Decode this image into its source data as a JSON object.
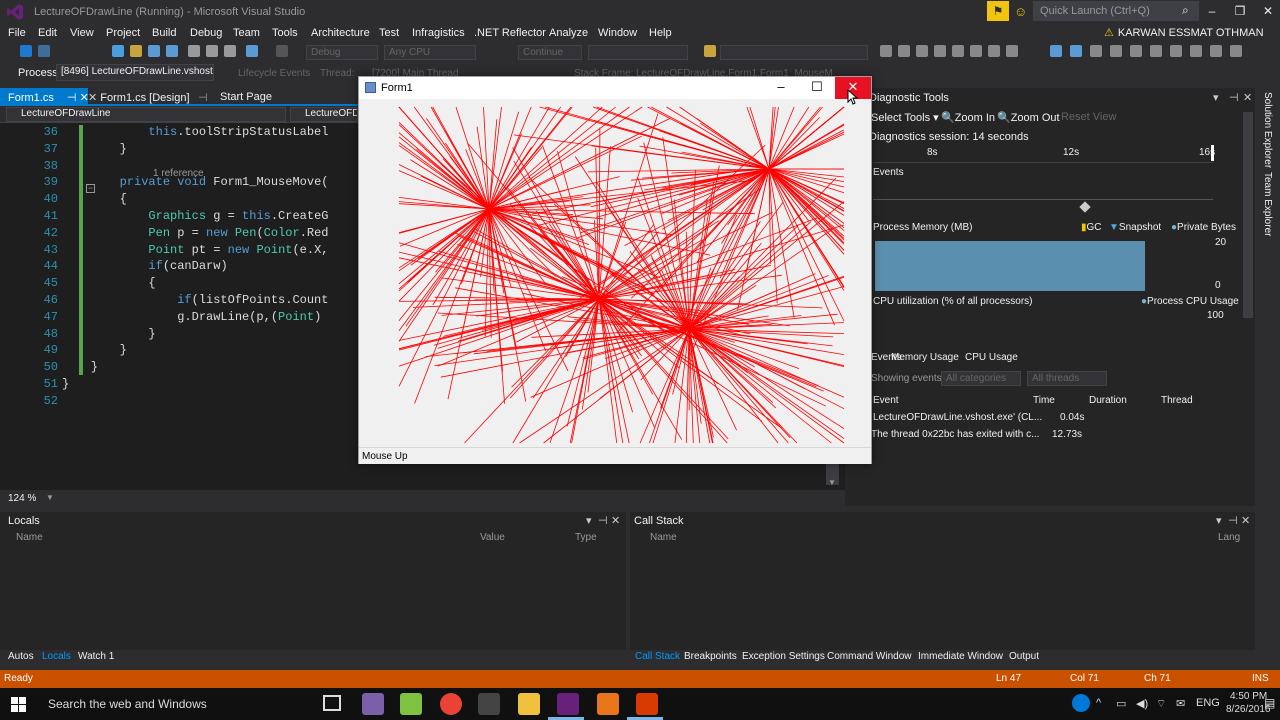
{
  "window": {
    "title": "LectureOFDrawLine (Running) - Microsoft Visual Studio",
    "quick_launch": "Quick Launch (Ctrl+Q)",
    "user": "KARWAN ESSMAT OTHMAN"
  },
  "menu": [
    "File",
    "Edit",
    "View",
    "Project",
    "Build",
    "Debug",
    "Team",
    "Tools",
    "Architecture",
    "Test",
    "Infragistics",
    ".NET Reflector",
    "Analyze",
    "Window",
    "Help"
  ],
  "toolbar": {
    "config": "Debug",
    "platform": "Any CPU",
    "continue": "Continue",
    "process_label": "Process:",
    "process_value": "[8496] LectureOFDrawLine.vshost.e",
    "lifecycle": "Lifecycle Events",
    "thread_label": "Thread:",
    "thread_value": "[7200] Main Thread",
    "stackframe_label": "Stack Frame:",
    "stackframe_value": "LectureOFDrawLine.Form1.Form1_MouseM"
  },
  "tabs": [
    {
      "label": "Form1.cs",
      "active": true
    },
    {
      "label": "Form1.cs [Design]",
      "active": false
    },
    {
      "label": "Start Page",
      "active": false
    }
  ],
  "navbar": {
    "project": "LectureOFDrawLine",
    "class": "LectureOFDra"
  },
  "editor": {
    "zoom": "124 %",
    "reference_hint": "1 reference",
    "lines": [
      {
        "n": "36",
        "text": "            this.toolStripStatusLabel"
      },
      {
        "n": "37",
        "text": "        }"
      },
      {
        "n": "38",
        "text": ""
      },
      {
        "n": "39",
        "text": "        private void Form1_MouseMove("
      },
      {
        "n": "40",
        "text": "        {"
      },
      {
        "n": "41",
        "text": "            Graphics g = this.CreateG"
      },
      {
        "n": "42",
        "text": "            Pen p = new Pen(Color.Red"
      },
      {
        "n": "43",
        "text": "            Point pt = new Point(e.X,"
      },
      {
        "n": "44",
        "text": "            if(canDarw)"
      },
      {
        "n": "45",
        "text": "            {"
      },
      {
        "n": "46",
        "text": "                if(listOfPoints.Count"
      },
      {
        "n": "47",
        "text": "                g.DrawLine(p,(Point)"
      },
      {
        "n": "48",
        "text": "            }"
      },
      {
        "n": "49",
        "text": "        }"
      },
      {
        "n": "50",
        "text": "    }"
      },
      {
        "n": "51",
        "text": "}"
      },
      {
        "n": "52",
        "text": ""
      }
    ]
  },
  "form1": {
    "title": "Form1",
    "status": "Mouse Up",
    "line_color": "#ff0000"
  },
  "diagnostics": {
    "title": "Diagnostic Tools",
    "select_tools": "Select Tools",
    "zoom_in": "Zoom In",
    "zoom_out": "Zoom Out",
    "reset_view": "Reset View",
    "session": "Diagnostics session: 14 seconds",
    "ticks": [
      "8s",
      "12s",
      "16s"
    ],
    "events_label": "Events",
    "memory_label": "Process Memory (MB)",
    "gc": "GC",
    "snapshot": "Snapshot",
    "private_bytes": "Private Bytes",
    "mem_max": "20",
    "mem_min": "0",
    "cpu_label": "CPU utilization (% of all processors)",
    "cpu_legend": "Process CPU Usage",
    "cpu_max": "100",
    "subtabs": [
      "Events",
      "Memory Usage",
      "CPU Usage"
    ],
    "showing": "Showing events for:",
    "all_categories": "All categories",
    "all_threads": "All threads",
    "cols": [
      "Event",
      "Time",
      "Duration",
      "Thread"
    ],
    "rows": [
      {
        "event": "LectureOFDrawLine.vshost.exe' (CL...",
        "time": "0.04s"
      },
      {
        "event": "The thread 0x22bc has exited with c...",
        "time": "12.73s"
      }
    ],
    "memory_color": "#5b8fb0"
  },
  "locals": {
    "title": "Locals",
    "cols": [
      "Name",
      "Value",
      "Type"
    ],
    "tabs": [
      {
        "label": "Autos",
        "sel": false
      },
      {
        "label": "Locals",
        "sel": true
      },
      {
        "label": "Watch 1",
        "sel": false
      }
    ]
  },
  "callstack": {
    "title": "Call Stack",
    "cols": [
      "Name",
      "Lang"
    ],
    "tabs": [
      {
        "label": "Call Stack",
        "sel": true
      },
      {
        "label": "Breakpoints",
        "sel": false
      },
      {
        "label": "Exception Settings",
        "sel": false
      },
      {
        "label": "Command Window",
        "sel": false
      },
      {
        "label": "Immediate Window",
        "sel": false
      },
      {
        "label": "Output",
        "sel": false
      }
    ]
  },
  "status": {
    "ready": "Ready",
    "ln": "Ln 47",
    "col": "Col 71",
    "ch": "Ch 71",
    "ins": "INS"
  },
  "side_tabs": [
    "Solution Explorer",
    "Team Explorer"
  ],
  "taskbar": {
    "search": "Search the web and Windows",
    "lang": "ENG",
    "time": "4:50 PM",
    "date": "8/26/2016"
  }
}
